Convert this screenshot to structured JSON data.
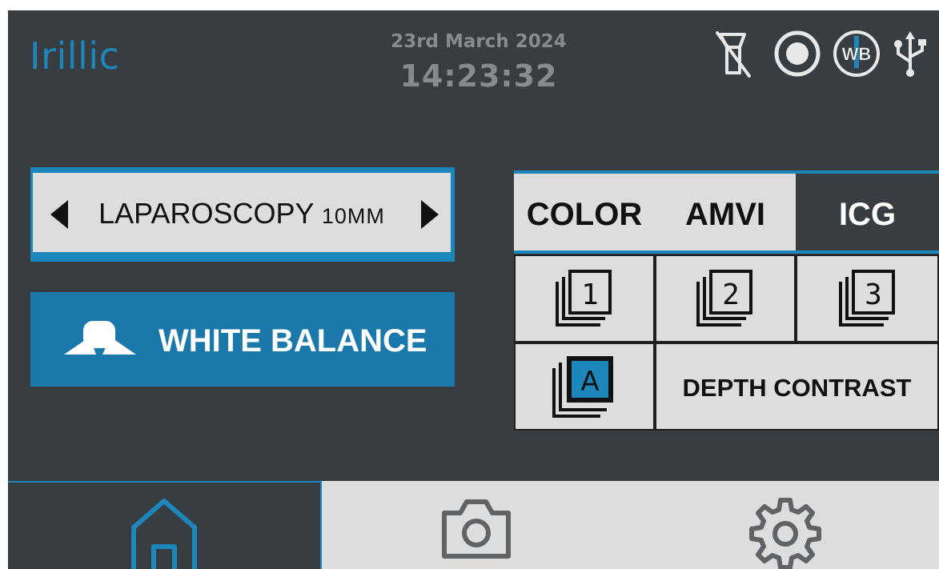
{
  "header": {
    "brand": "Irillic",
    "date": "23rd March 2024",
    "time": "14:23:32"
  },
  "status_icons": [
    {
      "icon": "no-flash-icon"
    },
    {
      "icon": "record-icon"
    },
    {
      "icon": "white-balance-status-icon",
      "label": "WB"
    },
    {
      "icon": "usb-icon"
    }
  ],
  "procedure": {
    "label_main": "LAPAROSCOPY ",
    "label_size": "10MM"
  },
  "white_balance": {
    "label": "WHITE BALANCE",
    "icon": "white-balance-icon"
  },
  "modes": {
    "tabs": [
      {
        "label": "COLOR",
        "selected": false
      },
      {
        "label": "AMVI",
        "selected": false
      },
      {
        "label": "ICG",
        "selected": true
      }
    ]
  },
  "presets": {
    "items": [
      {
        "label": "1",
        "icon": "preset-1-icon"
      },
      {
        "label": "2",
        "icon": "preset-2-icon"
      },
      {
        "label": "3",
        "icon": "preset-3-icon"
      },
      {
        "label": "A",
        "icon": "preset-auto-icon"
      }
    ],
    "depth_contrast": "DEPTH CONTRAST"
  },
  "nav": {
    "items": [
      {
        "icon": "home-icon",
        "selected": true
      },
      {
        "icon": "camera-icon",
        "selected": false
      },
      {
        "icon": "gear-icon",
        "selected": false
      }
    ]
  },
  "colors": {
    "accent": "#1d87bc",
    "button": "#1a78ab",
    "background": "#383d41",
    "panel": "#dddddd",
    "text_muted": "#888b8e"
  }
}
